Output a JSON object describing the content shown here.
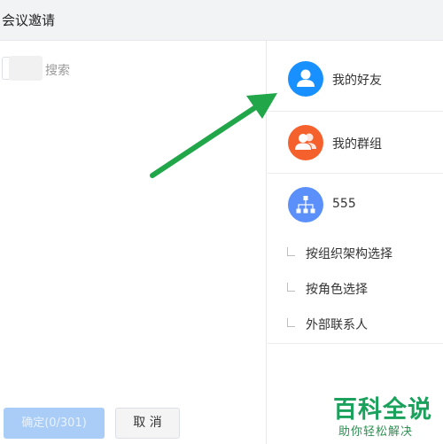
{
  "header": {
    "title": "会议邀请"
  },
  "search": {
    "placeholder": "搜索"
  },
  "footer": {
    "confirm_label": "确定(0/301)",
    "cancel_label": "取 消"
  },
  "sidebar": {
    "items": [
      {
        "label": "我的好友",
        "icon": "user-icon",
        "color": "#1890ff"
      },
      {
        "label": "我的群组",
        "icon": "group-icon",
        "color": "#f5612d"
      },
      {
        "label": "555",
        "icon": "org-tree-icon",
        "color": "#5b8ff9"
      }
    ],
    "sub_items": [
      {
        "label": "按组织架构选择"
      },
      {
        "label": "按角色选择"
      },
      {
        "label": "外部联系人"
      }
    ]
  },
  "annotation": {
    "arrow_color": "#21a64a"
  },
  "watermark": {
    "title": "百科全说",
    "subtitle": "助你轻松解决"
  }
}
